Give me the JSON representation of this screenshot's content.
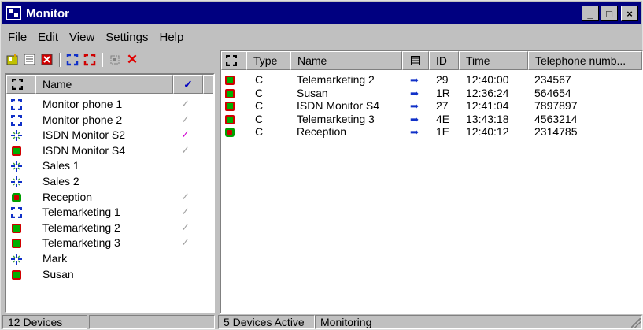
{
  "window": {
    "title": "Monitor",
    "controls": {
      "minimize": "_",
      "maximize": "□",
      "close": "×"
    }
  },
  "menu": [
    "File",
    "Edit",
    "View",
    "Settings",
    "Help"
  ],
  "left_toolbar": {
    "icons": [
      "new-device-icon",
      "properties-icon",
      "delete-device-icon",
      "monitor-on-icon",
      "monitor-off-icon",
      "select-all-icon",
      "remove-icon"
    ],
    "remove_glyph": "✕"
  },
  "devices": {
    "columns": {
      "status": "",
      "name": "Name",
      "check": "✓"
    },
    "rows": [
      {
        "name": "Monitor phone 1",
        "state": "blue",
        "check": "✓",
        "check_color": "grey"
      },
      {
        "name": "Monitor phone 2",
        "state": "blue",
        "check": "✓",
        "check_color": "grey"
      },
      {
        "name": "ISDN Monitor S2",
        "state": "star",
        "check": "✓",
        "check_color": "magenta"
      },
      {
        "name": "ISDN Monitor S4",
        "state": "green",
        "check": "✓",
        "check_color": "grey"
      },
      {
        "name": "Sales 1",
        "state": "star",
        "check": "",
        "check_color": "grey"
      },
      {
        "name": "Sales 2",
        "state": "star",
        "check": "",
        "check_color": "grey"
      },
      {
        "name": "Reception",
        "state": "greenred",
        "check": "✓",
        "check_color": "grey"
      },
      {
        "name": "Telemarketing 1",
        "state": "blue",
        "check": "✓",
        "check_color": "grey"
      },
      {
        "name": "Telemarketing 2",
        "state": "green",
        "check": "✓",
        "check_color": "grey"
      },
      {
        "name": "Telemarketing 3",
        "state": "green",
        "check": "✓",
        "check_color": "grey"
      },
      {
        "name": "Mark",
        "state": "star",
        "check": "",
        "check_color": "grey"
      },
      {
        "name": "Susan",
        "state": "green",
        "check": "",
        "check_color": "grey"
      }
    ]
  },
  "calls": {
    "columns": {
      "status": "",
      "type": "Type",
      "name": "Name",
      "dir": "",
      "id": "ID",
      "time": "Time",
      "phone": "Telephone numb..."
    },
    "rows": [
      {
        "state": "green",
        "type": "C",
        "name": "Telemarketing 2",
        "dir": "➡",
        "id": "29",
        "time": "12:40:00",
        "phone": "234567"
      },
      {
        "state": "green",
        "type": "C",
        "name": "Susan",
        "dir": "➡",
        "id": "1R",
        "time": "12:36:24",
        "phone": "564654"
      },
      {
        "state": "green",
        "type": "C",
        "name": "ISDN Monitor S4",
        "dir": "➡",
        "id": "27",
        "time": "12:41:04",
        "phone": "7897897"
      },
      {
        "state": "green",
        "type": "C",
        "name": "Telemarketing 3",
        "dir": "➡",
        "id": "4E",
        "time": "13:43:18",
        "phone": "4563214"
      },
      {
        "state": "greenred",
        "type": "C",
        "name": "Reception",
        "dir": "➡",
        "id": "1E",
        "time": "12:40:12",
        "phone": "2314785"
      }
    ]
  },
  "status_bar": {
    "left": "12 Devices",
    "middle": "",
    "right1": "5 Devices Active",
    "right2": "Monitoring"
  },
  "colors": {
    "titlebar": "#000080",
    "device_active": "#00a000",
    "device_blue": "#1030c8",
    "check_magenta": "#d000d0"
  }
}
